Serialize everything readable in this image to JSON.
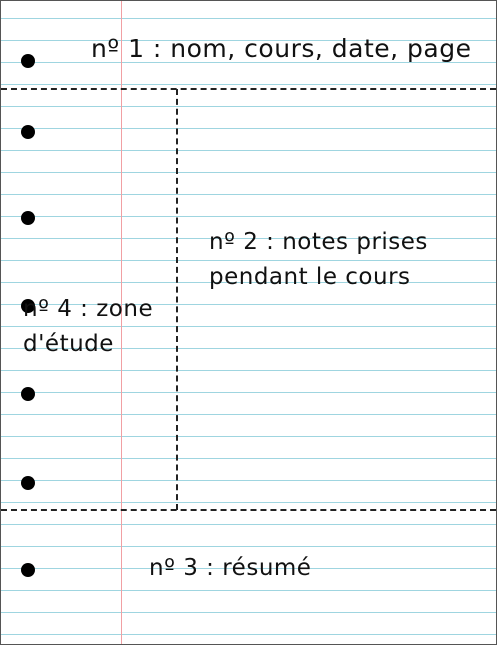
{
  "colors": {
    "ruled_line": "#9fd5e0",
    "margin_line": "#f1a0a3",
    "holes": "#000000",
    "dashed_divider": "#222222",
    "text": "#111111"
  },
  "sections": {
    "header": {
      "text": "nº 1 : nom, cours, date, page"
    },
    "notes": {
      "lines": [
        "nº 2 : notes prises",
        "pendant le cours"
      ]
    },
    "summary": {
      "text": "nº 3 : résumé"
    },
    "study": {
      "lines": [
        "nº 4 : zone",
        "d'étude"
      ]
    }
  }
}
